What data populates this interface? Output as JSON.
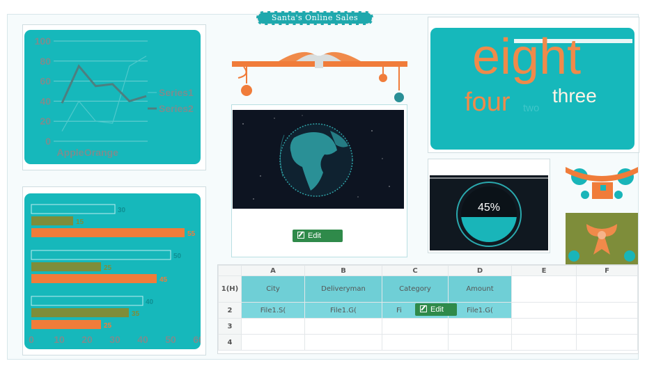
{
  "page": {
    "title": "Santa's Online Sales"
  },
  "line_chart": {
    "chart_data": {
      "type": "line",
      "categories": [
        "Apple",
        "",
        "Orange",
        "",
        "",
        ""
      ],
      "series": [
        {
          "name": "Series1",
          "values": [
            10,
            40,
            20,
            18,
            75,
            85
          ]
        },
        {
          "name": "Series2",
          "values": [
            38,
            75,
            55,
            57,
            40,
            45
          ]
        }
      ],
      "ylim": [
        0,
        100
      ],
      "yticks": [
        "100",
        "80",
        "60",
        "40",
        "20",
        "0"
      ],
      "xticklabels": [
        "Apple",
        "Orange"
      ],
      "legend": "right"
    },
    "colors": {
      "Series1": "#4fc9cc",
      "Series2": "#4d7f80"
    }
  },
  "bar_chart": {
    "chart_data": {
      "type": "bar",
      "orientation": "horizontal",
      "groups": [
        {
          "values": [
            30,
            15,
            55
          ]
        },
        {
          "values": [
            50,
            25,
            45
          ]
        },
        {
          "values": [
            40,
            35,
            25
          ]
        }
      ],
      "xticks": [
        "0",
        "10",
        "20",
        "30",
        "40",
        "50",
        "60"
      ],
      "xlim": [
        0,
        60
      ],
      "value_labels": [
        [
          "30",
          "15",
          "55"
        ],
        [
          "50",
          "25",
          "45"
        ],
        [
          "40",
          "35",
          "25"
        ]
      ]
    },
    "colors": [
      "#17b7ba",
      "#7e8d3a",
      "#f07c3a"
    ]
  },
  "globe_panel": {
    "edit_label": "Edit"
  },
  "word_cloud": {
    "words": [
      {
        "text": "eight",
        "color": "#f08a4a"
      },
      {
        "text": "four",
        "color": "#f08a4a"
      },
      {
        "text": "two",
        "color": "#3fc6c9"
      },
      {
        "text": "three",
        "color": "#fff3e6"
      }
    ]
  },
  "gauge": {
    "value_text": "45%",
    "value": 0.45
  },
  "sheet": {
    "columns": [
      "A",
      "B",
      "C",
      "D",
      "E",
      "F"
    ],
    "rows": [
      "1(H)",
      "2",
      "3",
      "4"
    ],
    "header_cells": [
      "City",
      "Deliveryman",
      "Category",
      "Amount"
    ],
    "data_cells": [
      "File1.S(",
      "File1.G(",
      "Fi",
      "File1.G("
    ],
    "edit_label": "Edit"
  }
}
